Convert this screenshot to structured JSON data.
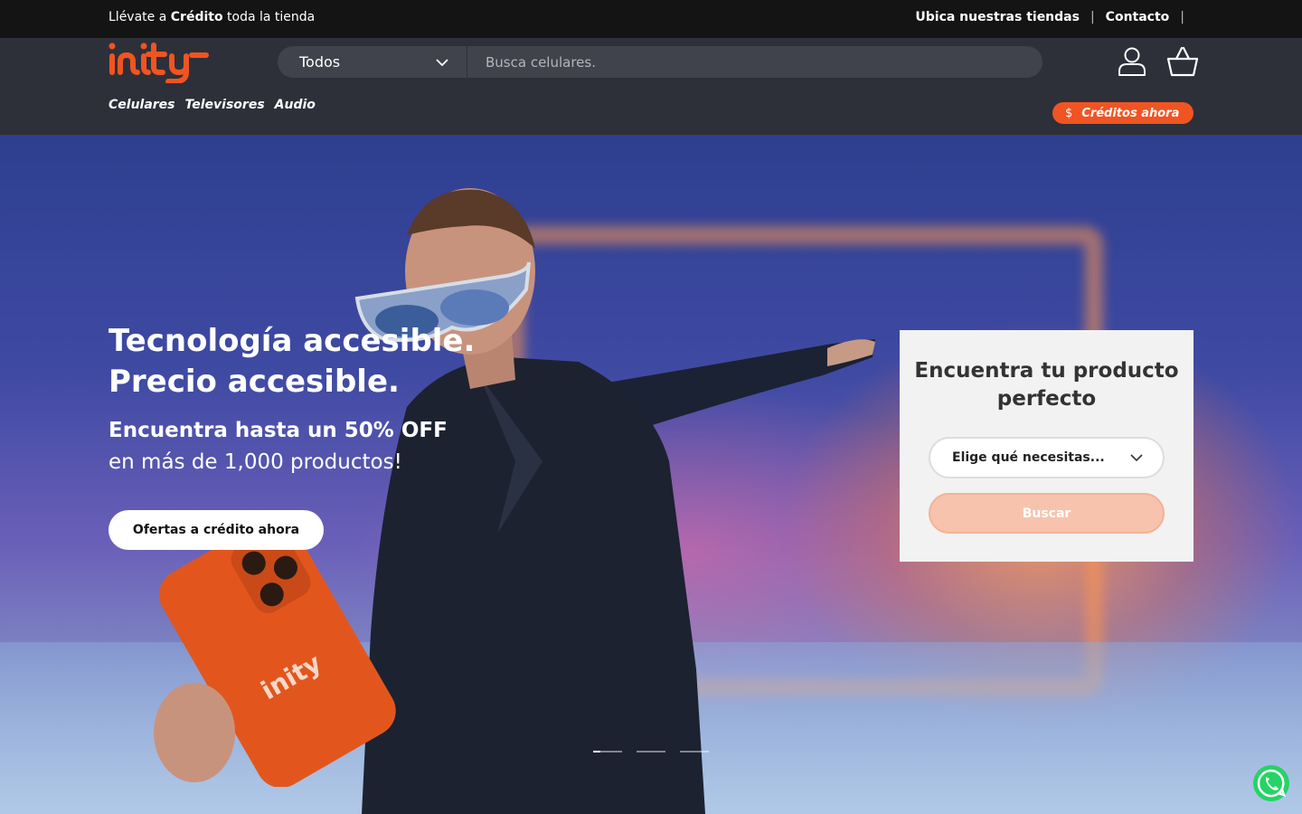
{
  "topbar": {
    "promo_prefix": "Llévate a",
    "promo_bold": "Crédito",
    "promo_suffix": "toda la tienda",
    "links": [
      "Ubica nuestras tiendas",
      "Contacto"
    ],
    "separator": "|"
  },
  "header": {
    "brand": "inity",
    "category_select": "Todos",
    "search_placeholder": "Busca celulares.",
    "nav": [
      "Celulares",
      "Televisores",
      "Audio"
    ],
    "credit_button": "Créditos ahora",
    "credit_icon_glyph": "$",
    "icons": [
      "user-icon",
      "cart-icon",
      "chevron-down-icon"
    ]
  },
  "hero": {
    "title": "Tecnología accesible. Precio accesible.",
    "subtitle_bold": "Encuentra hasta un 50% OFF",
    "subtitle": "en más de 1,000 productos!",
    "cta": "Ofertas a crédito ahora",
    "slides_total": 3,
    "slide_active": 1,
    "phone_brand": "inity"
  },
  "finder": {
    "title": "Encuentra tu producto perfecto",
    "select_placeholder": "Elige qué necesitas...",
    "button": "Buscar"
  },
  "colors": {
    "accent": "#f05422",
    "header_bg": "#2d3039",
    "topbar_bg": "#141414",
    "finder_button_disabled": "#f7c3ad",
    "whatsapp": "#25d366"
  }
}
